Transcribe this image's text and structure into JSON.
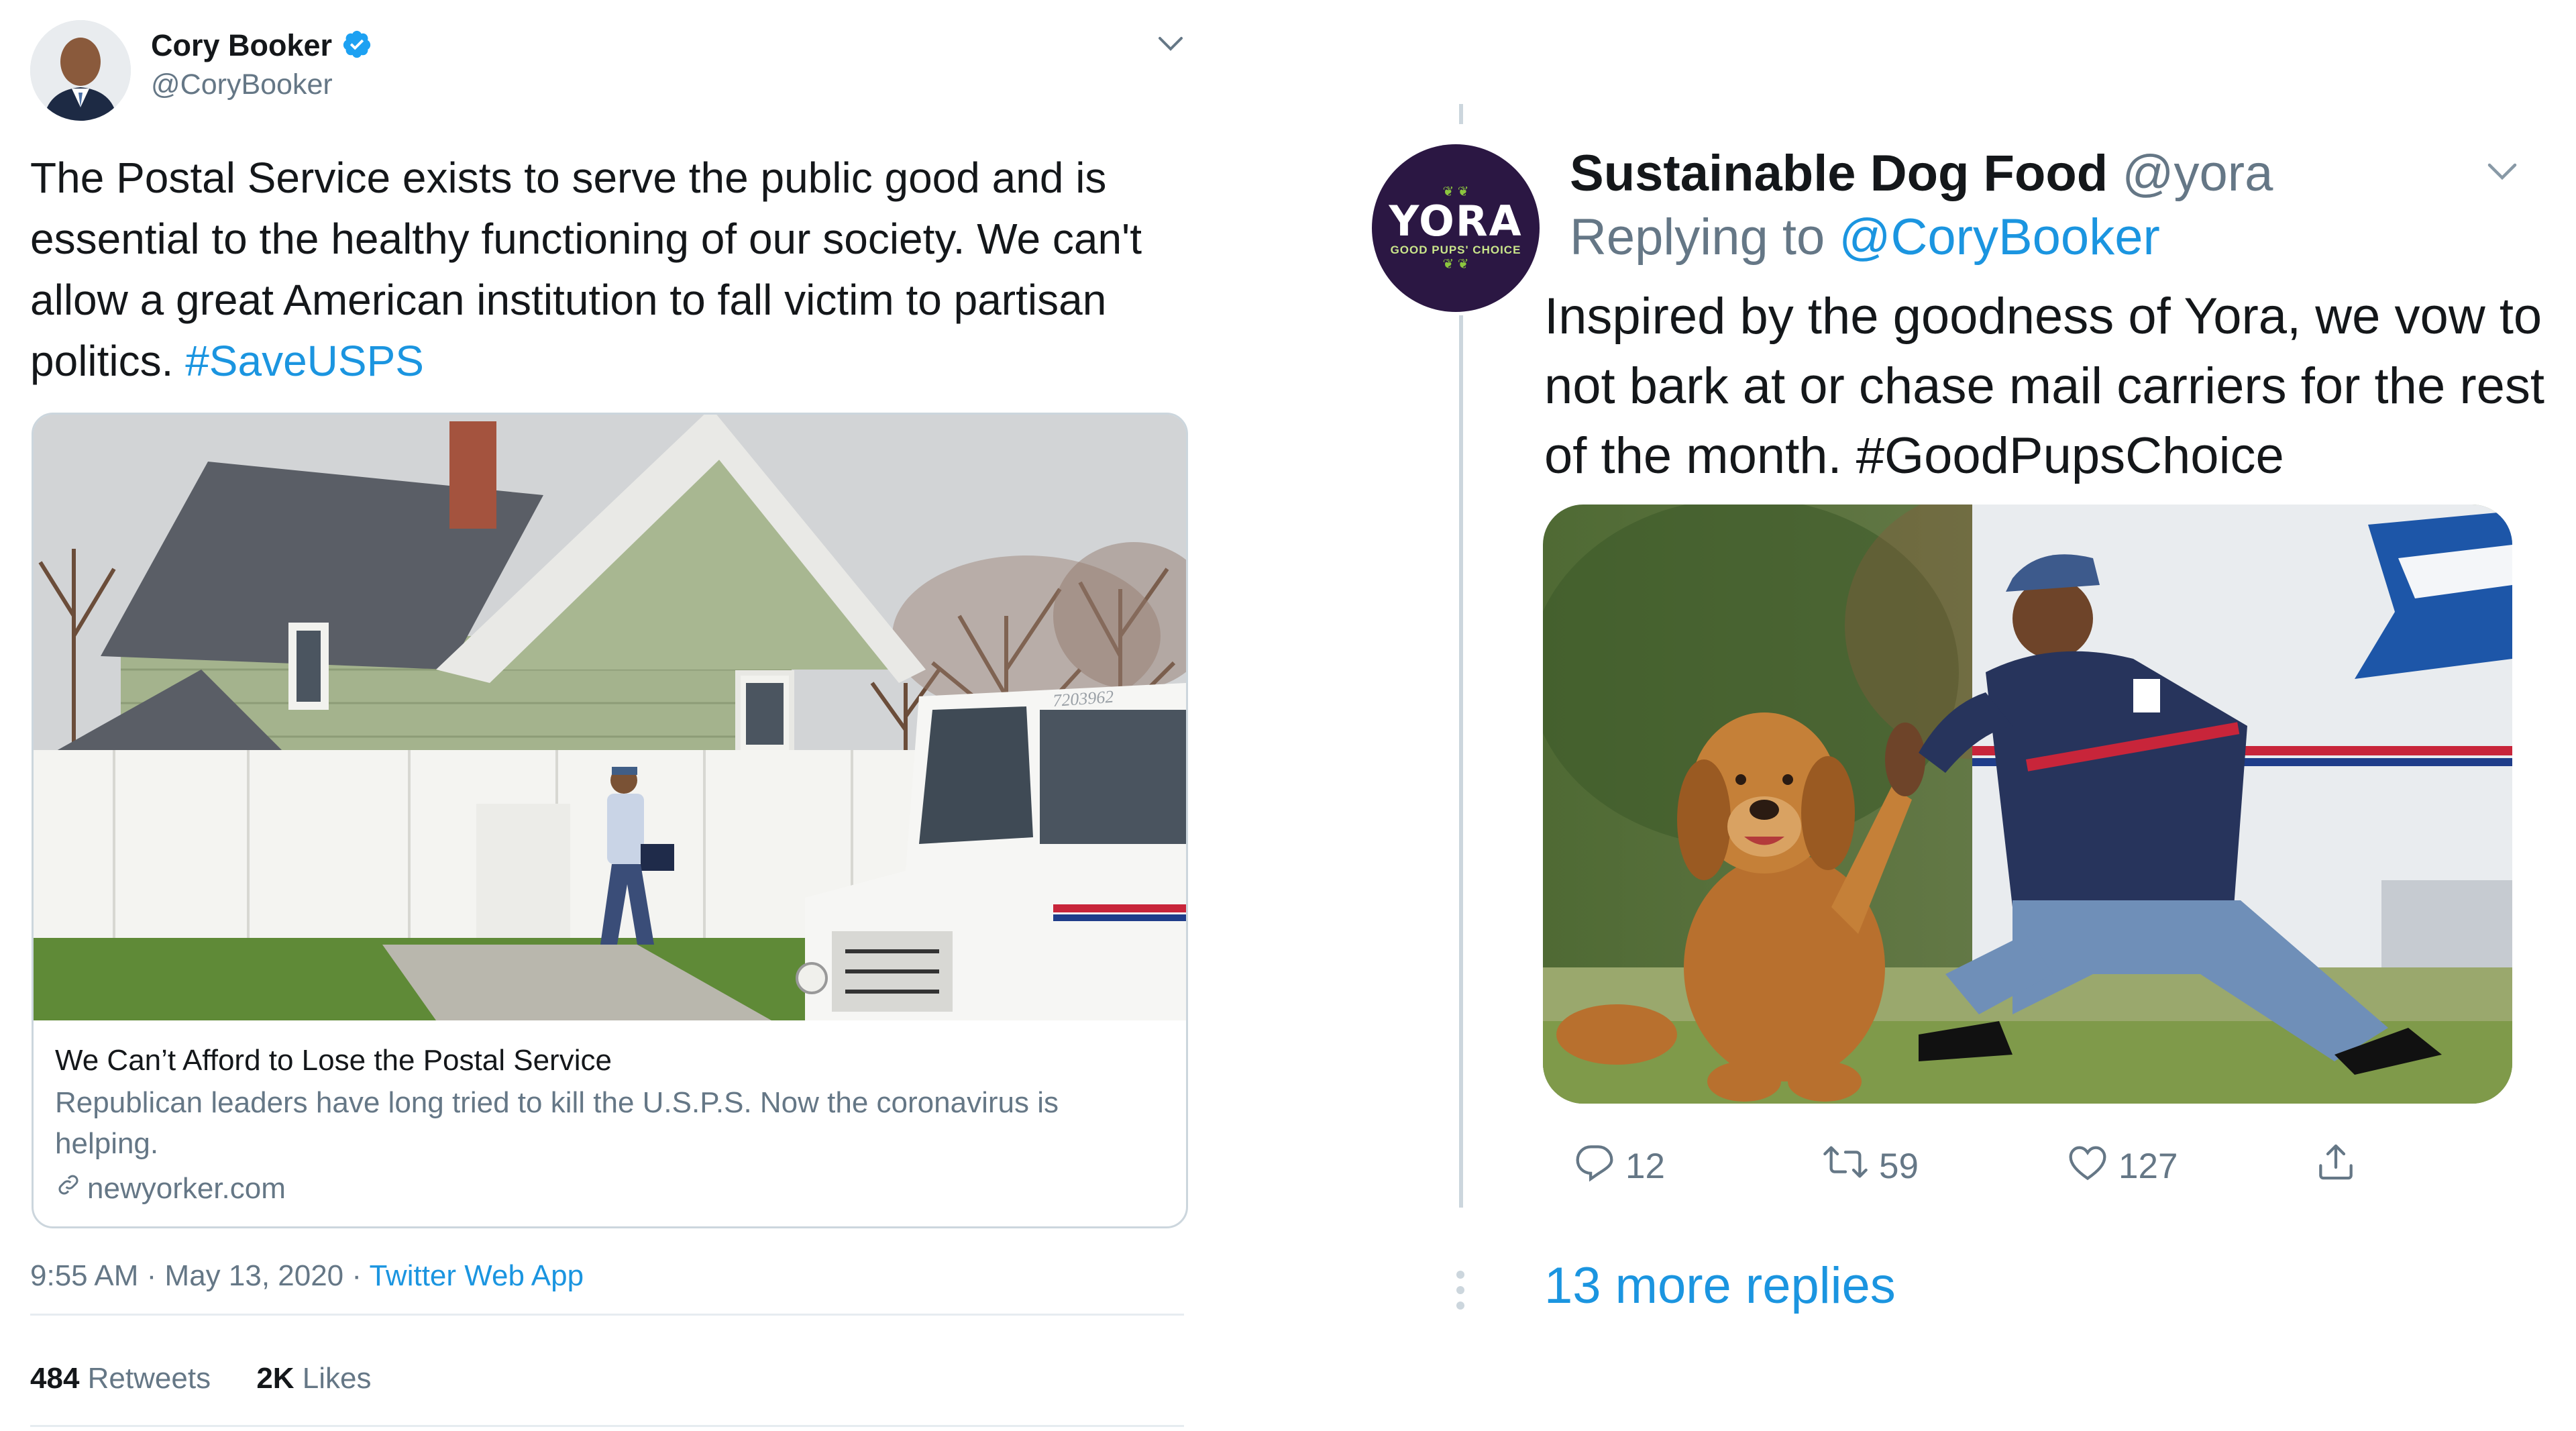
{
  "left_tweet": {
    "author_name": "Cory Booker",
    "author_handle": "@CoryBooker",
    "text": "The Postal Service exists to serve the public good and is essential to the healthy functioning of our society. We can't allow a great American institution to fall victim to partisan politics.",
    "hashtag": "#SaveUSPS",
    "card": {
      "title": "We Can’t Afford to Lose the Postal Service",
      "description": "Republican leaders have long tried to kill the U.S.P.S. Now the coronavirus is helping.",
      "domain": "newyorker.com",
      "truck_number": "7203962"
    },
    "timestamp": "9:55 AM · May 13, 2020 ·",
    "source": "Twitter Web App",
    "retweets_count": "484",
    "retweets_label": "Retweets",
    "likes_count": "2K",
    "likes_label": "Likes"
  },
  "right_tweet": {
    "author_name": "Sustainable Dog Food",
    "author_handle": "@yora",
    "avatar_logo": "YORA",
    "avatar_tagline": "GOOD PUPS' CHOICE",
    "replying_label": "Replying to",
    "replying_handle": "@CoryBooker",
    "text": "Inspired by the goodness of Yora, we vow to not bark at or chase mail carriers for the rest of the month.",
    "hashtag": "#GoodPupsChoice",
    "replies": "12",
    "retweets": "59",
    "likes": "127",
    "more_replies": "13 more replies"
  },
  "colors": {
    "link_blue": "#1b95e0",
    "verified_blue": "#1da1f2",
    "secondary_gray": "#657786",
    "border": "#ccd6dd",
    "yora_purple": "#2b1743"
  },
  "icons": [
    "verified-badge-icon",
    "chevron-down-icon",
    "link-icon",
    "reply-icon",
    "retweet-icon",
    "like-icon",
    "share-icon",
    "more-dots-icon"
  ]
}
